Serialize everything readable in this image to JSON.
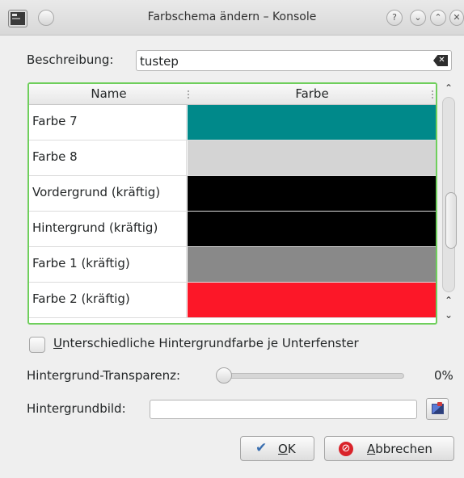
{
  "window": {
    "title": "Farbschema ändern – Konsole",
    "help_glyph": "?",
    "minimize_glyph": "⌄",
    "maximize_glyph": "⌃",
    "close_glyph": "✕"
  },
  "description": {
    "label": "Beschreibung:",
    "value": "tustep",
    "clear_glyph": "✕"
  },
  "table": {
    "headers": [
      "Name",
      "Farbe"
    ],
    "rows": [
      {
        "name": "Farbe 7",
        "color": "#00898a"
      },
      {
        "name": "Farbe 8",
        "color": "#d4d4d4"
      },
      {
        "name": "Vordergrund (kräftig)",
        "color": "#000000"
      },
      {
        "name": "Hintergrund (kräftig)",
        "color": "#000000"
      },
      {
        "name": "Farbe 1 (kräftig)",
        "color": "#898989"
      },
      {
        "name": "Farbe 2 (kräftig)",
        "color": "#fc1728"
      }
    ],
    "scroll_up_glyph": "⌃",
    "scroll_down_glyph": "⌄"
  },
  "checkbox": {
    "mnemonic": "U",
    "label_rest": "nterschiedliche Hintergrundfarbe je Unterfenster",
    "checked": false
  },
  "transparency": {
    "label": "Hintergrund-Transparenz:",
    "value_text": "0%",
    "value": 0
  },
  "background_image": {
    "label": "Hintergrundbild:",
    "value": ""
  },
  "buttons": {
    "ok_mnemonic": "O",
    "ok_rest": "K",
    "ok_glyph": "✔",
    "cancel_mnemonic": "A",
    "cancel_rest": "bbrechen",
    "cancel_glyph": "⊘"
  }
}
